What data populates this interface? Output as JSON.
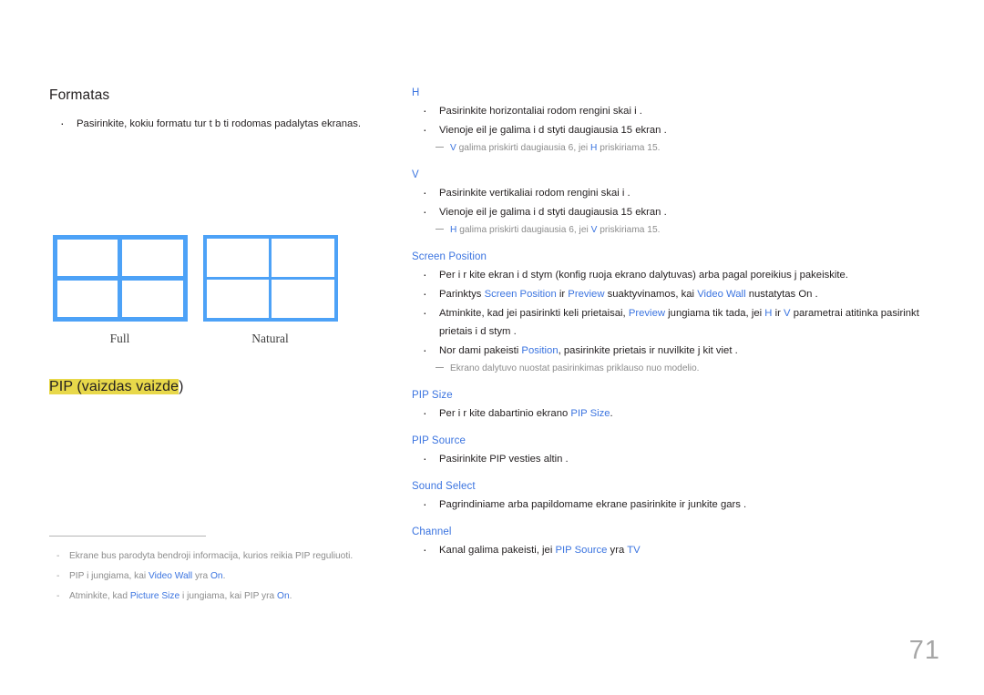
{
  "page": {
    "number": "71"
  },
  "left": {
    "format_heading": "Formatas",
    "format_bullets": [
      "Pasirinkite, kokiu formatu tur t  b ti rodomas padalytas ekranas."
    ],
    "diagrams": [
      {
        "caption": "Full",
        "style": "full"
      },
      {
        "caption": "Natural",
        "style": "natural"
      }
    ],
    "pip_heading_highlighted": "PIP (vaizdas vaizde",
    "pip_heading_tail": ")",
    "footnotes": [
      {
        "parts": [
          {
            "text": "Ekrane bus parodyta bendroji informacija, kurios reikia PIP reguliuoti.",
            "color": "grey"
          }
        ]
      },
      {
        "parts": [
          {
            "text": "PIP i jungiama, kai ",
            "color": "grey"
          },
          {
            "text": "Video Wall",
            "color": "blue"
          },
          {
            "text": " yra ",
            "color": "grey"
          },
          {
            "text": "On",
            "color": "blue"
          },
          {
            "text": ".",
            "color": "grey"
          }
        ]
      },
      {
        "parts": [
          {
            "text": "Atminkite, kad ",
            "color": "grey"
          },
          {
            "text": "Picture Size",
            "color": "blue"
          },
          {
            "text": " i jungiama, kai PIP yra ",
            "color": "grey"
          },
          {
            "text": "On",
            "color": "blue"
          },
          {
            "text": ".",
            "color": "grey"
          }
        ]
      }
    ]
  },
  "right": {
    "sections": [
      {
        "heading": "H",
        "bullets": [
          "Pasirinkite horizontaliai rodom  rengini  skai i .",
          "Vienoje eil je galima i d styti daugiausia 15 ekran ."
        ],
        "subnotes": [
          {
            "parts": [
              {
                "text": "V",
                "color": "blue"
              },
              {
                "text": " galima priskirti daugiausia 6, jei ",
                "color": "grey"
              },
              {
                "text": "H",
                "color": "blue"
              },
              {
                "text": " priskiriama 15.",
                "color": "grey"
              }
            ]
          }
        ]
      },
      {
        "heading": "V",
        "bullets": [
          "Pasirinkite vertikaliai rodom  rengini  skai i .",
          "Vienoje eil je galima i d styti daugiausia 15 ekran ."
        ],
        "subnotes": [
          {
            "parts": [
              {
                "text": "H",
                "color": "blue"
              },
              {
                "text": " galima priskirti daugiausia 6, jei ",
                "color": "grey"
              },
              {
                "text": "V",
                "color": "blue"
              },
              {
                "text": " priskiriama 15.",
                "color": "grey"
              }
            ]
          }
        ]
      },
      {
        "heading": "Screen Position",
        "rich_bullets": [
          {
            "parts": [
              {
                "text": "Per i r kite ekran  i d stym  (konfig ruoja ekrano dalytuvas) arba pagal poreikius j  pakeiskite.",
                "color": "black"
              }
            ]
          },
          {
            "parts": [
              {
                "text": "Parinktys ",
                "color": "black"
              },
              {
                "text": "Screen Position",
                "color": "blue"
              },
              {
                "text": " ir ",
                "color": "black"
              },
              {
                "text": "Preview",
                "color": "blue"
              },
              {
                "text": " suaktyvinamos, kai ",
                "color": "black"
              },
              {
                "text": "Video Wall",
                "color": "blue"
              },
              {
                "text": " nustatytas   On .",
                "color": "black"
              }
            ]
          },
          {
            "parts": [
              {
                "text": "Atminkite, kad jei pasirinkti keli prietaisai, ",
                "color": "black"
              },
              {
                "text": "Preview",
                "color": "blue"
              },
              {
                "text": " jungiama tik tada, jei ",
                "color": "black"
              },
              {
                "text": "H",
                "color": "blue"
              },
              {
                "text": " ir ",
                "color": "black"
              },
              {
                "text": "V",
                "color": "blue"
              },
              {
                "text": " parametrai atitinka pasirinkt  prietais  i d stym .",
                "color": "black"
              }
            ]
          },
          {
            "parts": [
              {
                "text": "Nor dami pakeisti ",
                "color": "black"
              },
              {
                "text": "Position",
                "color": "blue"
              },
              {
                "text": ", pasirinkite prietais  ir nuvilkite j   kit  viet .",
                "color": "black"
              }
            ]
          }
        ],
        "subnotes": [
          {
            "parts": [
              {
                "text": "Ekrano dalytuvo nuostat  pasirinkimas priklauso nuo modelio.",
                "color": "grey"
              }
            ]
          }
        ]
      },
      {
        "heading": "PIP Size",
        "rich_bullets": [
          {
            "parts": [
              {
                "text": "Per i r kite dabartinio ekrano ",
                "color": "black"
              },
              {
                "text": "PIP Size",
                "color": "blue"
              },
              {
                "text": ".",
                "color": "black"
              }
            ]
          }
        ]
      },
      {
        "heading": "PIP Source",
        "bullets": [
          "Pasirinkite PIP  vesties  altin ."
        ]
      },
      {
        "heading": "Sound Select",
        "bullets": [
          "Pagrindiniame arba papildomame ekrane pasirinkite ir  junkite gars ."
        ]
      },
      {
        "heading": "Channel",
        "rich_bullets": [
          {
            "parts": [
              {
                "text": "Kanal  galima pakeisti, jei ",
                "color": "black"
              },
              {
                "text": "PIP Source",
                "color": "blue"
              },
              {
                "text": " yra ",
                "color": "black"
              },
              {
                "text": "TV",
                "color": "blue"
              }
            ]
          }
        ]
      }
    ]
  },
  "colors": {
    "accent_blue": "#3b74e0",
    "diagram_blue": "#4da2f7",
    "highlight_yellow": "#e8d84a",
    "grey_text": "#8c8c8c",
    "page_number_grey": "#a6a6a6"
  }
}
